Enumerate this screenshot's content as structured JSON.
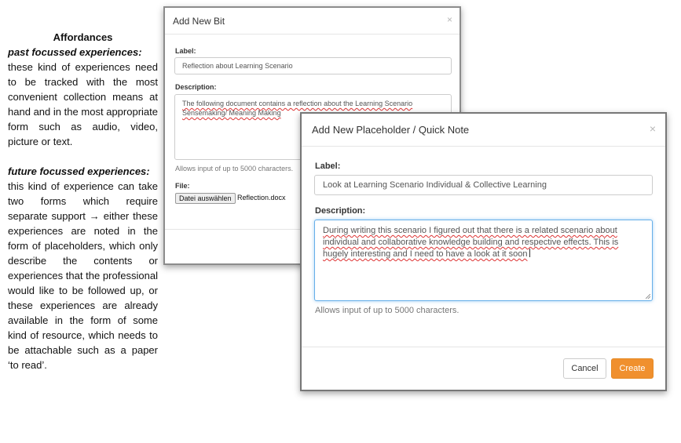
{
  "doc": {
    "heading": "Affordances",
    "past_title": "past focussed experiences:",
    "past_body": "these kind of experiences need to be tracked with the most convenient collection means at hand and in the most appropriate form such as audio, video, picture or text.",
    "future_title": "future focussed experiences:",
    "future_body": "this kind of experience can take two forms which require separate support → either these experiences are noted in the form of placeholders, which only describe the contents or experiences that the professional would like to be followed up, or these experiences are already available in the form of some kind of resource, which needs to be attachable such as a paper ‘to read’."
  },
  "bit_modal": {
    "title": "Add New Bit",
    "close": "×",
    "label_label": "Label:",
    "label_value": "Reflection about Learning Scenario",
    "description_label": "Description:",
    "description_line1": "The following document contains a reflection about the Learning Scenario",
    "description_line2": "Sensemaking/ Meaning Making",
    "help": "Allows input of up to 5000 characters.",
    "file_label": "File:",
    "file_button": "Datei auswählen",
    "file_name": "Reflection.docx"
  },
  "placeholder_modal": {
    "title": "Add New Placeholder / Quick Note",
    "close": "×",
    "label_label": "Label:",
    "label_value": "Look at Learning Scenario Individual & Collective Learning",
    "description_label": "Description:",
    "description_value": "During writing this scenario I figured out that there is a related scenario about individual and collaborative knowledge building and respective effects. This is hugely interesting and I need to have a look at it soon",
    "help": "Allows input of up to 5000 characters.",
    "cancel": "Cancel",
    "create": "Create"
  },
  "colors": {
    "accent": "#f0902e",
    "focus": "#66afe9"
  }
}
